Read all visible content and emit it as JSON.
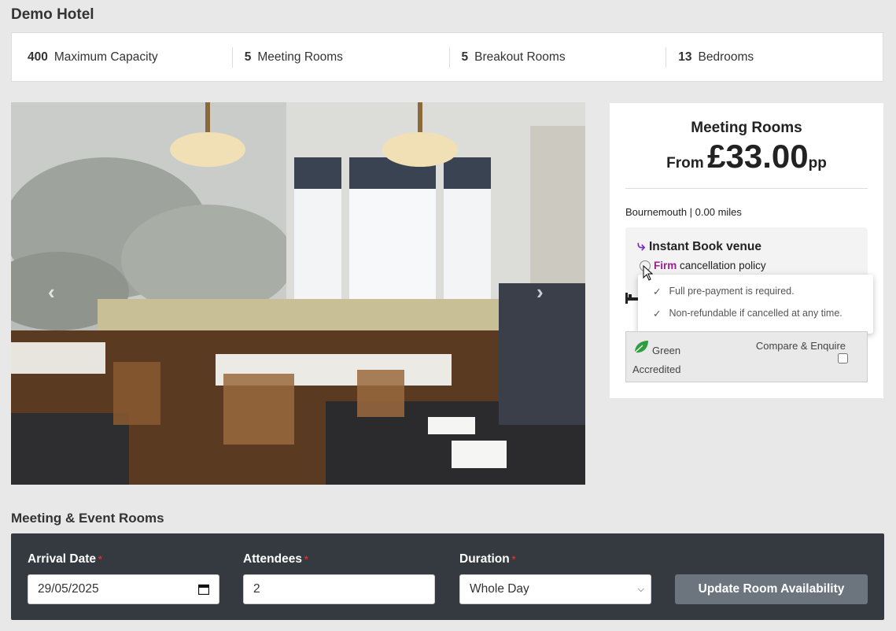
{
  "hotel": {
    "name": "Demo Hotel"
  },
  "stats": [
    {
      "value": "400",
      "label": "Maximum Capacity"
    },
    {
      "value": "5",
      "label": "Meeting Rooms"
    },
    {
      "value": "5",
      "label": "Breakout Rooms"
    },
    {
      "value": "13",
      "label": "Bedrooms"
    }
  ],
  "carousel": {
    "prev_icon": "chevron-left-icon",
    "next_icon": "chevron-right-icon"
  },
  "pricing": {
    "title": "Meeting Rooms",
    "from_label": "From",
    "amount": "£33.00",
    "unit": "pp"
  },
  "location": {
    "text": "Bournemouth | 0.00 miles"
  },
  "instant": {
    "label": "Instant Book venue",
    "policy_strong": "Firm",
    "policy_rest": " cancellation policy",
    "tooltip": [
      "Full pre-payment is required.",
      "Non-refundable if cancelled at any time."
    ]
  },
  "green": {
    "label": "Green Accredited"
  },
  "compare": {
    "label": "Compare & Enquire"
  },
  "meeting": {
    "section_title": "Meeting & Event Rooms",
    "arrival_label": "Arrival Date",
    "arrival_value": "29/05/2025",
    "attendees_label": "Attendees",
    "attendees_value": "2",
    "duration_label": "Duration",
    "duration_value": "Whole Day",
    "required_mark": "*",
    "update_button": "Update Room Availability"
  },
  "colors": {
    "accent_purple": "#7b2fbf",
    "firm": "#9c1f8c",
    "panel": "#343a40",
    "required": "#e0302a"
  }
}
